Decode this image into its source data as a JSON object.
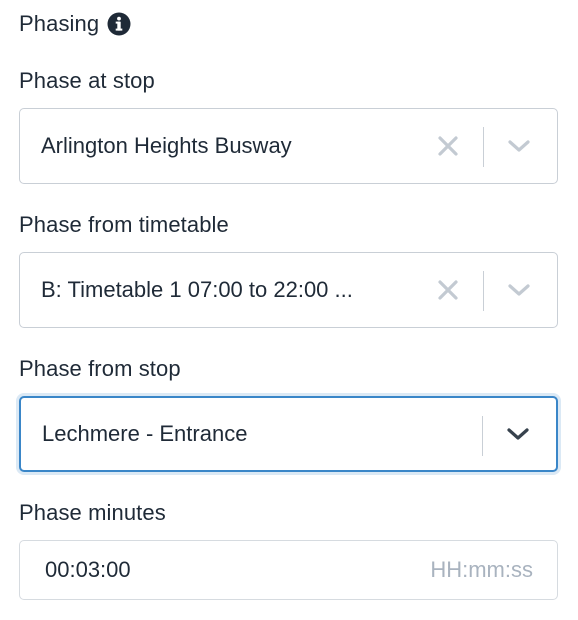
{
  "section": {
    "title": "Phasing",
    "info_icon": "info-circle-icon"
  },
  "phase_at_stop": {
    "label": "Phase at stop",
    "value": "Arlington Heights Busway",
    "clear_icon": "clear-icon",
    "dropdown_icon": "chevron-down-icon"
  },
  "phase_from_timetable": {
    "label": "Phase from timetable",
    "value": "B: Timetable 1 07:00 to 22:00 ...",
    "clear_icon": "clear-icon",
    "dropdown_icon": "chevron-down-icon"
  },
  "phase_from_stop": {
    "label": "Phase from stop",
    "value": "Lechmere - Entrance",
    "dropdown_icon": "chevron-down-icon",
    "focused": true
  },
  "phase_minutes": {
    "label": "Phase minutes",
    "value": "00:03:00",
    "placeholder": "HH:mm:ss"
  },
  "colors": {
    "text": "#1f2a37",
    "border": "#c9cfd6",
    "icon_muted": "#c3cad2",
    "icon_dark": "#37424d",
    "focus": "#3a86c8",
    "placeholder": "#a9b3bf"
  }
}
